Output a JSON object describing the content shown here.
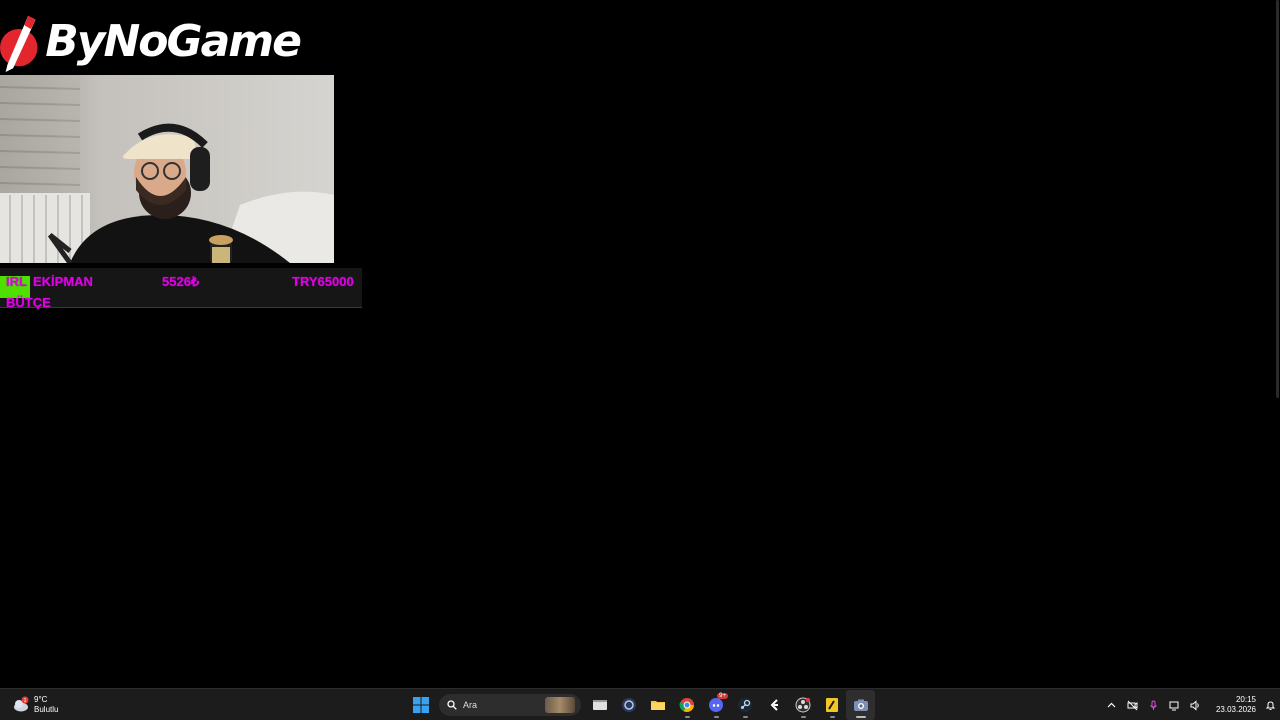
{
  "overlay": {
    "logo_text": "ByNoGame",
    "ticker": {
      "irl": "IRL",
      "equipment": "EKİPMAN",
      "amount": "5526₺",
      "target": "TRY65000",
      "budget": "BÜTÇE"
    }
  },
  "taskbar": {
    "weather": {
      "temp": "9°C",
      "condition": "Bulutlu",
      "alert_count": "1"
    },
    "search": {
      "placeholder": "Ara"
    },
    "discord_badge": "9+",
    "clock": {
      "time": "20:15",
      "date": "23.03.2026"
    }
  },
  "colors": {
    "ticker_text": "#e000e8",
    "ticker_green": "#4fe000",
    "taskbar_bg": "#1c1c1c",
    "background": "#000000"
  },
  "icons": [
    "weather-icon",
    "windows-start-icon",
    "search-icon",
    "file-explorer-icon",
    "chrome-icon",
    "discord-icon",
    "steam-icon",
    "obs-icon",
    "camera-icon"
  ]
}
